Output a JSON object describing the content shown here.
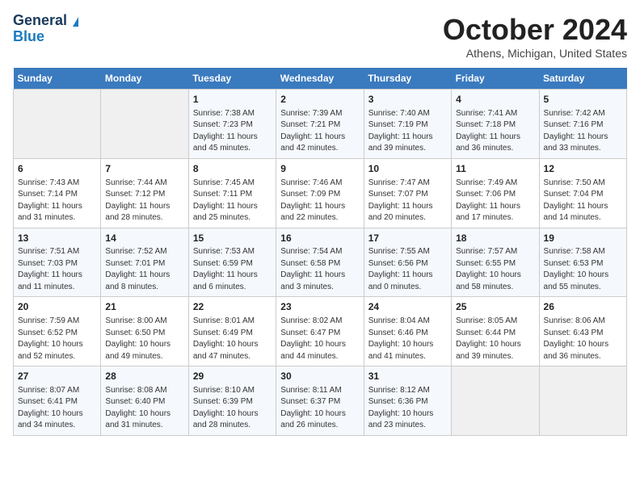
{
  "header": {
    "logo_general": "General",
    "logo_blue": "Blue",
    "month_title": "October 2024",
    "location": "Athens, Michigan, United States"
  },
  "weekdays": [
    "Sunday",
    "Monday",
    "Tuesday",
    "Wednesday",
    "Thursday",
    "Friday",
    "Saturday"
  ],
  "weeks": [
    [
      {
        "day": "",
        "sunrise": "",
        "sunset": "",
        "daylight": ""
      },
      {
        "day": "",
        "sunrise": "",
        "sunset": "",
        "daylight": ""
      },
      {
        "day": "1",
        "sunrise": "Sunrise: 7:38 AM",
        "sunset": "Sunset: 7:23 PM",
        "daylight": "Daylight: 11 hours and 45 minutes."
      },
      {
        "day": "2",
        "sunrise": "Sunrise: 7:39 AM",
        "sunset": "Sunset: 7:21 PM",
        "daylight": "Daylight: 11 hours and 42 minutes."
      },
      {
        "day": "3",
        "sunrise": "Sunrise: 7:40 AM",
        "sunset": "Sunset: 7:19 PM",
        "daylight": "Daylight: 11 hours and 39 minutes."
      },
      {
        "day": "4",
        "sunrise": "Sunrise: 7:41 AM",
        "sunset": "Sunset: 7:18 PM",
        "daylight": "Daylight: 11 hours and 36 minutes."
      },
      {
        "day": "5",
        "sunrise": "Sunrise: 7:42 AM",
        "sunset": "Sunset: 7:16 PM",
        "daylight": "Daylight: 11 hours and 33 minutes."
      }
    ],
    [
      {
        "day": "6",
        "sunrise": "Sunrise: 7:43 AM",
        "sunset": "Sunset: 7:14 PM",
        "daylight": "Daylight: 11 hours and 31 minutes."
      },
      {
        "day": "7",
        "sunrise": "Sunrise: 7:44 AM",
        "sunset": "Sunset: 7:12 PM",
        "daylight": "Daylight: 11 hours and 28 minutes."
      },
      {
        "day": "8",
        "sunrise": "Sunrise: 7:45 AM",
        "sunset": "Sunset: 7:11 PM",
        "daylight": "Daylight: 11 hours and 25 minutes."
      },
      {
        "day": "9",
        "sunrise": "Sunrise: 7:46 AM",
        "sunset": "Sunset: 7:09 PM",
        "daylight": "Daylight: 11 hours and 22 minutes."
      },
      {
        "day": "10",
        "sunrise": "Sunrise: 7:47 AM",
        "sunset": "Sunset: 7:07 PM",
        "daylight": "Daylight: 11 hours and 20 minutes."
      },
      {
        "day": "11",
        "sunrise": "Sunrise: 7:49 AM",
        "sunset": "Sunset: 7:06 PM",
        "daylight": "Daylight: 11 hours and 17 minutes."
      },
      {
        "day": "12",
        "sunrise": "Sunrise: 7:50 AM",
        "sunset": "Sunset: 7:04 PM",
        "daylight": "Daylight: 11 hours and 14 minutes."
      }
    ],
    [
      {
        "day": "13",
        "sunrise": "Sunrise: 7:51 AM",
        "sunset": "Sunset: 7:03 PM",
        "daylight": "Daylight: 11 hours and 11 minutes."
      },
      {
        "day": "14",
        "sunrise": "Sunrise: 7:52 AM",
        "sunset": "Sunset: 7:01 PM",
        "daylight": "Daylight: 11 hours and 8 minutes."
      },
      {
        "day": "15",
        "sunrise": "Sunrise: 7:53 AM",
        "sunset": "Sunset: 6:59 PM",
        "daylight": "Daylight: 11 hours and 6 minutes."
      },
      {
        "day": "16",
        "sunrise": "Sunrise: 7:54 AM",
        "sunset": "Sunset: 6:58 PM",
        "daylight": "Daylight: 11 hours and 3 minutes."
      },
      {
        "day": "17",
        "sunrise": "Sunrise: 7:55 AM",
        "sunset": "Sunset: 6:56 PM",
        "daylight": "Daylight: 11 hours and 0 minutes."
      },
      {
        "day": "18",
        "sunrise": "Sunrise: 7:57 AM",
        "sunset": "Sunset: 6:55 PM",
        "daylight": "Daylight: 10 hours and 58 minutes."
      },
      {
        "day": "19",
        "sunrise": "Sunrise: 7:58 AM",
        "sunset": "Sunset: 6:53 PM",
        "daylight": "Daylight: 10 hours and 55 minutes."
      }
    ],
    [
      {
        "day": "20",
        "sunrise": "Sunrise: 7:59 AM",
        "sunset": "Sunset: 6:52 PM",
        "daylight": "Daylight: 10 hours and 52 minutes."
      },
      {
        "day": "21",
        "sunrise": "Sunrise: 8:00 AM",
        "sunset": "Sunset: 6:50 PM",
        "daylight": "Daylight: 10 hours and 49 minutes."
      },
      {
        "day": "22",
        "sunrise": "Sunrise: 8:01 AM",
        "sunset": "Sunset: 6:49 PM",
        "daylight": "Daylight: 10 hours and 47 minutes."
      },
      {
        "day": "23",
        "sunrise": "Sunrise: 8:02 AM",
        "sunset": "Sunset: 6:47 PM",
        "daylight": "Daylight: 10 hours and 44 minutes."
      },
      {
        "day": "24",
        "sunrise": "Sunrise: 8:04 AM",
        "sunset": "Sunset: 6:46 PM",
        "daylight": "Daylight: 10 hours and 41 minutes."
      },
      {
        "day": "25",
        "sunrise": "Sunrise: 8:05 AM",
        "sunset": "Sunset: 6:44 PM",
        "daylight": "Daylight: 10 hours and 39 minutes."
      },
      {
        "day": "26",
        "sunrise": "Sunrise: 8:06 AM",
        "sunset": "Sunset: 6:43 PM",
        "daylight": "Daylight: 10 hours and 36 minutes."
      }
    ],
    [
      {
        "day": "27",
        "sunrise": "Sunrise: 8:07 AM",
        "sunset": "Sunset: 6:41 PM",
        "daylight": "Daylight: 10 hours and 34 minutes."
      },
      {
        "day": "28",
        "sunrise": "Sunrise: 8:08 AM",
        "sunset": "Sunset: 6:40 PM",
        "daylight": "Daylight: 10 hours and 31 minutes."
      },
      {
        "day": "29",
        "sunrise": "Sunrise: 8:10 AM",
        "sunset": "Sunset: 6:39 PM",
        "daylight": "Daylight: 10 hours and 28 minutes."
      },
      {
        "day": "30",
        "sunrise": "Sunrise: 8:11 AM",
        "sunset": "Sunset: 6:37 PM",
        "daylight": "Daylight: 10 hours and 26 minutes."
      },
      {
        "day": "31",
        "sunrise": "Sunrise: 8:12 AM",
        "sunset": "Sunset: 6:36 PM",
        "daylight": "Daylight: 10 hours and 23 minutes."
      },
      {
        "day": "",
        "sunrise": "",
        "sunset": "",
        "daylight": ""
      },
      {
        "day": "",
        "sunrise": "",
        "sunset": "",
        "daylight": ""
      }
    ]
  ]
}
